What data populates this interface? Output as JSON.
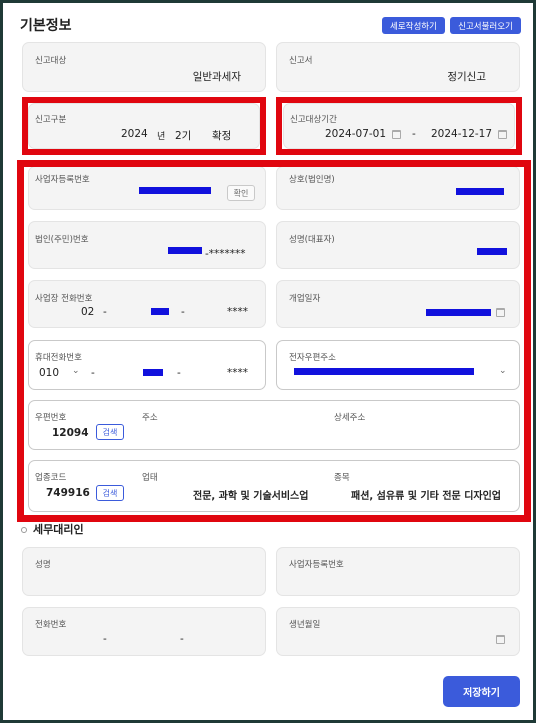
{
  "page": {
    "title": "기본정보",
    "btn_new": "세로작성하기",
    "btn_load": "신고서불러오기",
    "save": "저장하기"
  },
  "report_target": {
    "label": "신고대상",
    "value": "일반과세자"
  },
  "report_form": {
    "label": "신고서",
    "value": "정기신고"
  },
  "report_type": {
    "label": "신고구분",
    "year": "2024",
    "year_unit": "년",
    "period": "2기",
    "kind": "확정"
  },
  "report_period": {
    "label": "신고대상기간",
    "start": "2024-07-01",
    "sep": "-",
    "end": "2024-12-17"
  },
  "business_no": {
    "label": "사업자등록번호",
    "confirm": "확인"
  },
  "company_name": {
    "label": "상호(법인명)"
  },
  "corp_no": {
    "label": "법인(주민)번호",
    "masked": "-*******"
  },
  "rep_name": {
    "label": "성명(대표자)"
  },
  "biz_phone": {
    "label": "사업장 전화번호",
    "area": "02",
    "sep1": "-",
    "sep2": "-",
    "masked": "****"
  },
  "open_date": {
    "label": "개업일자"
  },
  "mobile": {
    "label": "휴대전화번호",
    "prefix": "010",
    "sep1": "-",
    "sep2": "-",
    "masked": "****"
  },
  "email": {
    "label": "전자우편주소"
  },
  "address": {
    "zip_label": "우편번호",
    "zip": "12094",
    "search": "검색",
    "addr_label": "주소",
    "detail_label": "상세주소"
  },
  "industry": {
    "code_label": "업종코드",
    "code": "749916",
    "search": "검색",
    "type_label": "업태",
    "type": "전문, 과학 및 기술서비스업",
    "item_label": "종목",
    "item": "패션, 섬유류 및 기타 전문 디자인업"
  },
  "agent": {
    "section_title": "세무대리인",
    "name_label": "성명",
    "biz_no_label": "사업자등록번호",
    "phone_label": "전화번호",
    "phone_sep1": "-",
    "phone_sep2": "-",
    "birth_label": "생년월일"
  },
  "colors": {
    "accent": "#3b5bdb",
    "highlight": "#e0060f",
    "redaction": "#1111dd",
    "frame": "#1f3a36"
  }
}
